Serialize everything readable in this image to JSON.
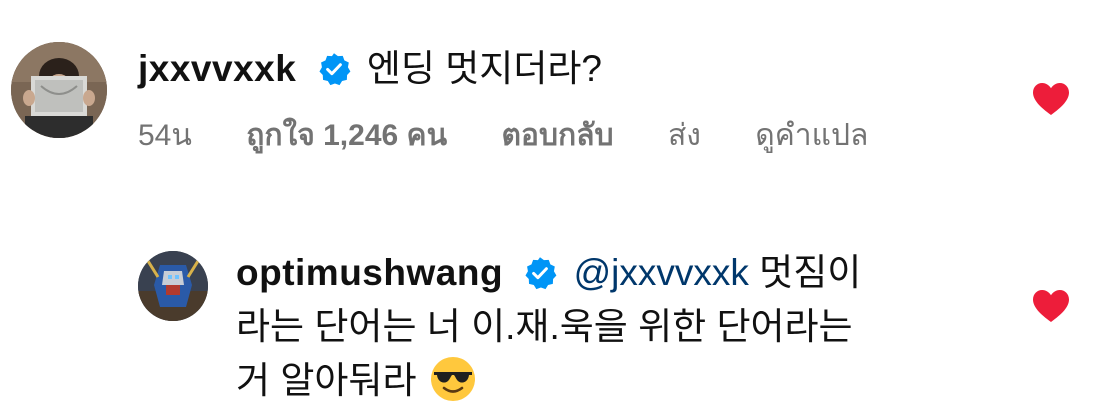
{
  "comment": {
    "username": "jxxvvxxk",
    "text": "엔딩 멋지더라?",
    "time": "54น",
    "likes": "ถูกใจ 1,246 คน",
    "reply_label": "ตอบกลับ",
    "send_label": "ส่ง",
    "translate_label": "ดูคำแปล",
    "liked": true
  },
  "reply": {
    "username": "optimushwang",
    "mention": "@jxxvvxxk",
    "text_line1": " 멋짐이",
    "text_line2": "라는 단어는 너 이.재.욱을 위한 단어라는",
    "text_line3": "거 알아둬라",
    "emoji": "smiling-face-with-sunglasses",
    "liked": true
  },
  "colors": {
    "heart": "#ed1d3a",
    "verified_badge": "#0095f6",
    "meta_text": "#737373",
    "mention": "#00376b"
  }
}
